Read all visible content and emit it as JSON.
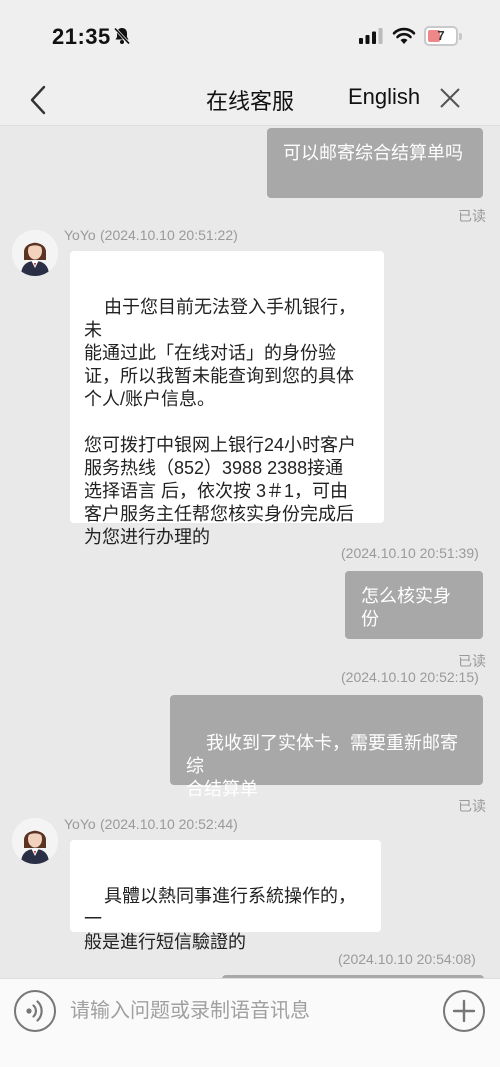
{
  "status_bar": {
    "time": "21:35",
    "battery": "7",
    "icons": [
      "bell-slash-icon",
      "signal-icon",
      "wifi-icon",
      "battery-icon"
    ]
  },
  "nav": {
    "title": "在线客服",
    "language_label": "English",
    "back_icon": "chevron-left-icon",
    "close_icon": "close-icon"
  },
  "messages": {
    "m1": {
      "text": "可以邮寄综合结算单吗",
      "status": "已读"
    },
    "m2": {
      "sender": "YoYo",
      "timestamp": "(2024.10.10 20:51:22)",
      "text": "由于您目前无法登入手机银行，未\n能通过此「在线对话」的身份验\n证，所以我暂未能查询到您的具体\n个人/账户信息。\n\n您可拨打中银网上银行24小时客户\n服务热线（852）3988 2388接通\n选择语言 后，依次按 3＃1，可由\n客户服务主任帮您核实身份完成后\n为您进行办理的"
    },
    "m3": {
      "timestamp": "(2024.10.10 20:51:39)",
      "text": "怎么核实身份",
      "status": "已读"
    },
    "m4": {
      "timestamp": "(2024.10.10 20:52:15)",
      "text": "我收到了实体卡，需要重新邮寄综\n合结算单",
      "status": "已读"
    },
    "m5": {
      "sender": "YoYo",
      "timestamp": "(2024.10.10 20:52:44)",
      "text": "具體以熱同事進行系統操作的，一\n般是進行短信驗證的"
    },
    "m6": {
      "timestamp": "(2024.10.10 20:54:08)"
    }
  },
  "input_bar": {
    "placeholder": "请输入问题或录制语音讯息",
    "voice_icon": "voice-icon",
    "add_icon": "plus-circle-icon"
  },
  "colors": {
    "outgoing_bubble": "#a8a8a8",
    "incoming_bubble": "#ffffff",
    "chat_background": "#e9e9e9",
    "meta_text": "#9a9a9a"
  }
}
